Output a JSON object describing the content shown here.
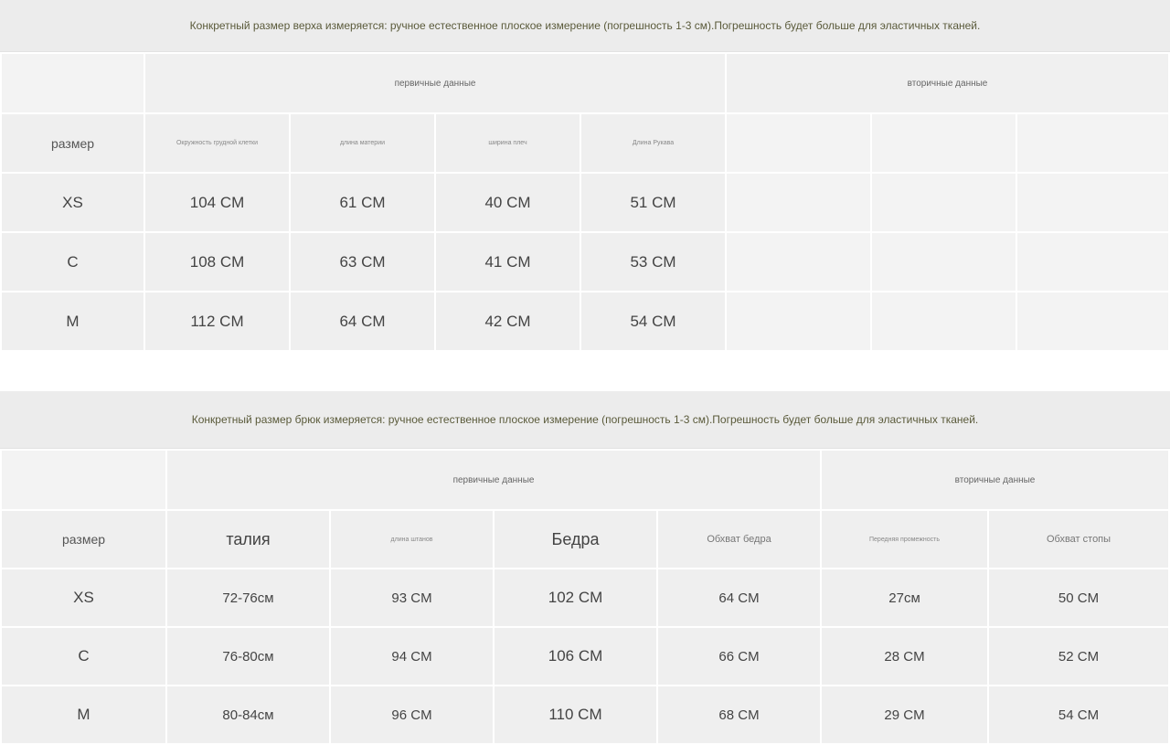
{
  "top": {
    "note": "Конкретный размер верха измеряется: ручное естественное плоское измерение (погрешность 1-3 см).Погрешность будет больше для эластичных тканей.",
    "primary_label": "первичные данные",
    "secondary_label": "вторичные данные",
    "size_label": "размер",
    "headers": [
      "Окружность грудной клетки",
      "длина материи",
      "ширина плеч",
      "Длина Рукава"
    ],
    "rows": [
      {
        "size": "XS",
        "values": [
          "104 CM",
          "61 CM",
          "40 CM",
          "51 CM"
        ]
      },
      {
        "size": "C",
        "values": [
          "108 CM",
          "63 CM",
          "41 CM",
          "53 CM"
        ]
      },
      {
        "size": "M",
        "values": [
          "112 CM",
          "64 CM",
          "42 CM",
          "54 CM"
        ]
      }
    ]
  },
  "bottom": {
    "note": "Конкретный размер брюк измеряется: ручное естественное плоское измерение (погрешность 1-3 см).Погрешность будет больше для эластичных тканей.",
    "primary_label": "первичные данные",
    "secondary_label": "вторичные данные",
    "size_label": "размер",
    "headers": [
      "талия",
      "длина штанов",
      "Бедра",
      "Обхват бедра",
      "Передняя промежность",
      "Обхват стопы"
    ],
    "rows": [
      {
        "size": "XS",
        "values": [
          "72-76см",
          "93 CM",
          "102 CM",
          "64 CM",
          "27см",
          "50 CM"
        ]
      },
      {
        "size": "C",
        "values": [
          "76-80см",
          "94 CM",
          "106 CM",
          "66 CM",
          "28 CM",
          "52 CM"
        ]
      },
      {
        "size": "M",
        "values": [
          "80-84см",
          "96 CM",
          "110 CM",
          "68 CM",
          "29 CM",
          "54 CM"
        ]
      }
    ]
  }
}
